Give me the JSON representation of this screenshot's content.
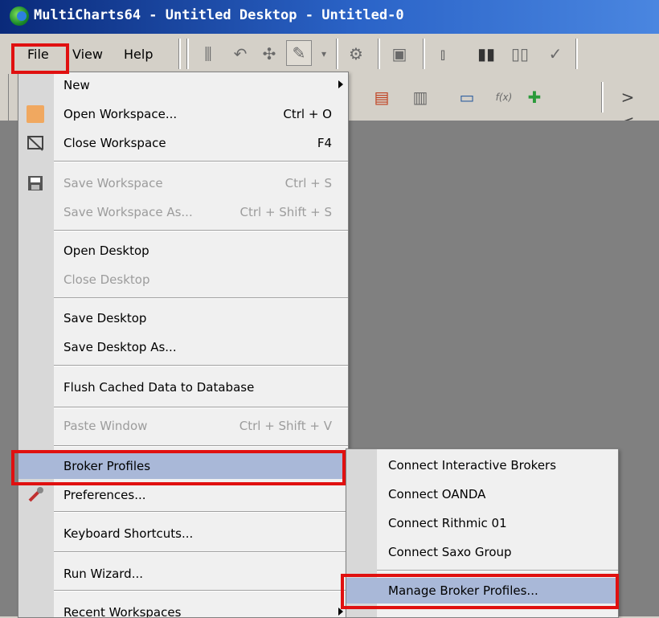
{
  "window": {
    "title": "MultiCharts64 - Untitled Desktop - Untitled-0"
  },
  "menubar": {
    "items": [
      "File",
      "View",
      "Help"
    ]
  },
  "file_menu": {
    "items": [
      {
        "label": "New",
        "shortcut": "",
        "enabled": true,
        "submenu": true
      },
      {
        "label": "Open Workspace...",
        "shortcut": "Ctrl + O",
        "enabled": true,
        "icon": "folder-icon"
      },
      {
        "label": "Close Workspace",
        "shortcut": "F4",
        "enabled": true,
        "icon": "close-workspace-icon"
      },
      {
        "label": "Save Workspace",
        "shortcut": "Ctrl + S",
        "enabled": false,
        "icon": "floppy-disk-icon"
      },
      {
        "label": "Save Workspace As...",
        "shortcut": "Ctrl + Shift + S",
        "enabled": false
      },
      {
        "label": "Open Desktop",
        "shortcut": "",
        "enabled": true
      },
      {
        "label": "Close Desktop",
        "shortcut": "",
        "enabled": false
      },
      {
        "label": "Save Desktop",
        "shortcut": "",
        "enabled": true
      },
      {
        "label": "Save Desktop As...",
        "shortcut": "",
        "enabled": true
      },
      {
        "label": "Flush Cached Data to Database",
        "shortcut": "",
        "enabled": true
      },
      {
        "label": "Paste Window",
        "shortcut": "Ctrl + Shift + V",
        "enabled": false
      },
      {
        "label": "Broker Profiles",
        "shortcut": "",
        "enabled": true,
        "selected": true
      },
      {
        "label": "Preferences...",
        "shortcut": "",
        "enabled": true,
        "icon": "wrench-icon"
      },
      {
        "label": "Keyboard Shortcuts...",
        "shortcut": "",
        "enabled": true
      },
      {
        "label": "Run Wizard...",
        "shortcut": "",
        "enabled": true
      },
      {
        "label": "Recent Workspaces",
        "shortcut": "",
        "enabled": true,
        "submenu": true
      }
    ]
  },
  "broker_submenu": {
    "items": [
      {
        "label": "Connect Interactive Brokers"
      },
      {
        "label": "Connect OANDA"
      },
      {
        "label": "Connect Rithmic 01"
      },
      {
        "label": "Connect Saxo Group"
      },
      {
        "label": "Manage Broker Profiles...",
        "selected": true
      }
    ]
  },
  "colors": {
    "highlight": "#e01010",
    "selection": "#a9b8d8",
    "titlebar": "#0a2a7a"
  }
}
